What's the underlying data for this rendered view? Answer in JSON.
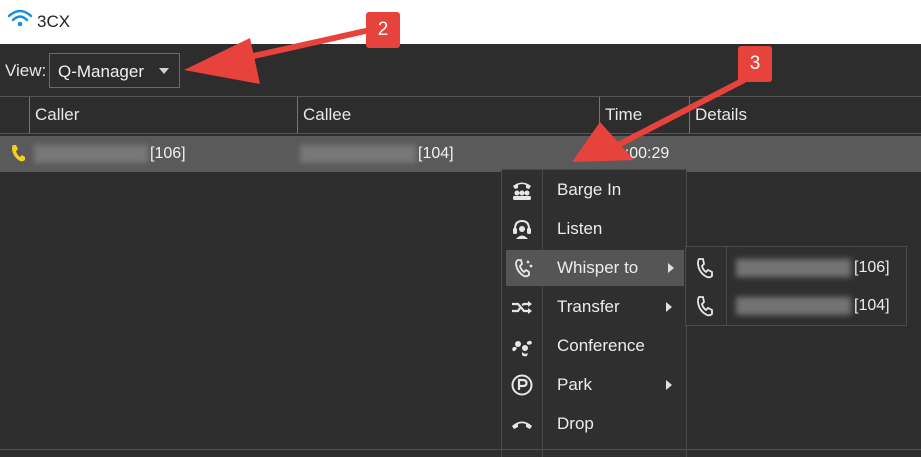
{
  "window": {
    "title": "3CX"
  },
  "toolbar": {
    "view_label": "View:",
    "view_value": "Q-Manager"
  },
  "table": {
    "columns": [
      "Caller",
      "Callee",
      "Time",
      "Details"
    ],
    "rows": [
      {
        "caller_ext": "[106]",
        "callee_ext": "[104]",
        "time": "00:00:29",
        "details": ""
      }
    ]
  },
  "context_menu": {
    "items": [
      {
        "label": "Barge In",
        "icon": "barge-in-icon",
        "submenu": false
      },
      {
        "label": "Listen",
        "icon": "headset-icon",
        "submenu": false
      },
      {
        "label": "Whisper to",
        "icon": "whisper-icon",
        "submenu": true,
        "highlighted": true
      },
      {
        "label": "Transfer",
        "icon": "transfer-icon",
        "submenu": true
      },
      {
        "label": "Conference",
        "icon": "conference-icon",
        "submenu": false
      },
      {
        "label": "Park",
        "icon": "park-icon",
        "submenu": true
      },
      {
        "label": "Drop",
        "icon": "hangup-icon",
        "submenu": false
      }
    ]
  },
  "whisper_submenu": {
    "items": [
      {
        "label": "[106]",
        "icon": "phone-icon"
      },
      {
        "label": "[104]",
        "icon": "phone-icon"
      }
    ]
  },
  "annotations": {
    "badge_2": "2",
    "badge_3": "3"
  },
  "colors": {
    "accent_blue": "#1c8fd9",
    "annotation_red": "#e8423d",
    "ringing_yellow": "#f2d21b"
  }
}
